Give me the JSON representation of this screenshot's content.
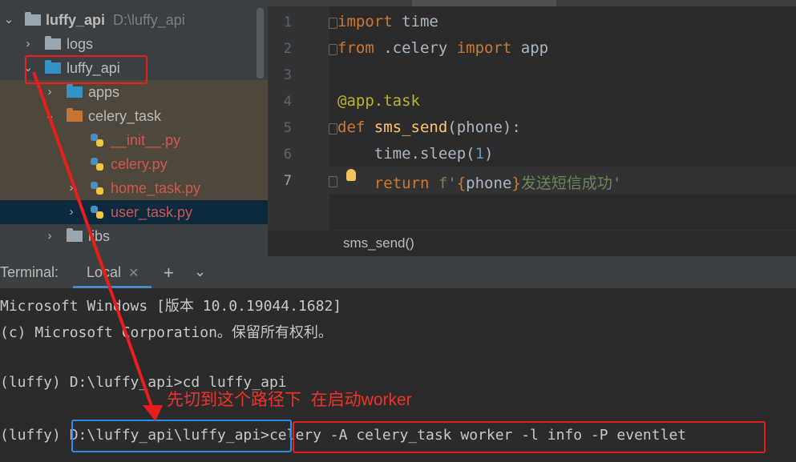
{
  "project_tree": {
    "root": {
      "name": "luffy_api",
      "path": "D:\\luffy_api"
    },
    "items": [
      {
        "label": "logs"
      },
      {
        "label": "luffy_api"
      },
      {
        "label": "apps"
      },
      {
        "label": "celery_task"
      },
      {
        "label": "__init__.py"
      },
      {
        "label": "celery.py"
      },
      {
        "label": "home_task.py"
      },
      {
        "label": "user_task.py"
      },
      {
        "label": "libs"
      }
    ]
  },
  "editor": {
    "line_numbers": [
      "1",
      "2",
      "3",
      "4",
      "5",
      "6",
      "7"
    ],
    "code": {
      "l1_kw": "import",
      "l1_rest": " time",
      "l2_kw": "from",
      "l2_mid": " .celery ",
      "l2_kw2": "import",
      "l2_rest": " app",
      "l4_dec": "@app.task",
      "l5_kw": "def",
      "l5_fn": "sms_send",
      "l5_rest": "(phone):",
      "l6_a": "    time.sleep(",
      "l6_num": "1",
      "l6_b": ")",
      "l7_kw": "    return",
      "l7_str1": " f'",
      "l7_br1": "{",
      "l7_var": "phone",
      "l7_br2": "}",
      "l7_str2": "发送短信成功'"
    },
    "breadcrumb": "sms_send()"
  },
  "terminal": {
    "title": "Terminal:",
    "tab_label": "Local",
    "lines": [
      "Microsoft Windows [版本 10.0.19044.1682]",
      "(c) Microsoft Corporation。保留所有权利。",
      "",
      "(luffy) D:\\luffy_api>cd luffy_api",
      "",
      "(luffy) D:\\luffy_api\\luffy_api>celery -A celery_task worker -l info -P eventlet"
    ]
  },
  "annotation": {
    "note": "先切到这个路径下  在启动worker",
    "color": "#f0312b"
  },
  "colors": {
    "tree_bg": "#3c3f41",
    "editor_bg": "#2b2b2b",
    "keyword": "#cc7832",
    "function": "#ffc66d",
    "accent": "#e81d1d"
  }
}
